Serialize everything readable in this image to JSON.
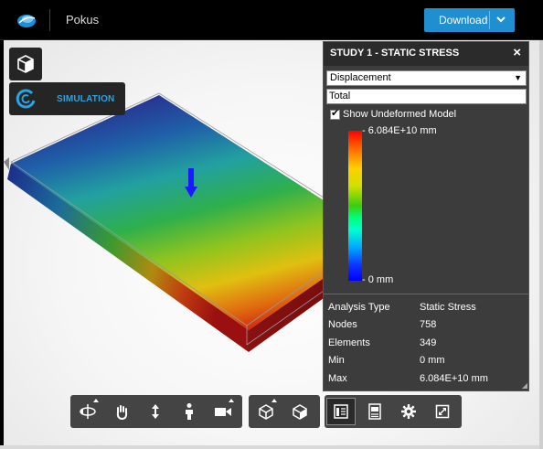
{
  "app": {
    "document_title": "Pokus",
    "download_label": "Download",
    "logo_icon": "fusion-logo-icon"
  },
  "left_tools": {
    "view_cube_icon": "view-cube-icon",
    "simulation_label": "SIMULATION",
    "simulation_icon": "simulation-icon"
  },
  "panel": {
    "title": "STUDY 1 - STATIC STRESS",
    "close_glyph": "×",
    "result_type": "Displacement",
    "component": "Total",
    "show_undeformed_label": "Show Undeformed Model",
    "show_undeformed_checked": true,
    "legend_max": "6.084E+10 mm",
    "legend_min": "0 mm",
    "legend_max_color": "#ff0000",
    "legend_min_color": "#0000ff",
    "info": [
      {
        "key": "Analysis Type",
        "value": "Static Stress"
      },
      {
        "key": "Nodes",
        "value": "758"
      },
      {
        "key": "Elements",
        "value": "349"
      },
      {
        "key": "Min",
        "value": "0 mm"
      },
      {
        "key": "Max",
        "value": "6.084E+10 mm"
      }
    ]
  },
  "toolbar": {
    "navigation": [
      "orbit-icon",
      "pan-icon",
      "zoom-icon",
      "look-at-icon",
      "camera-icon"
    ],
    "display": [
      "display-settings-icon",
      "view-icon"
    ],
    "simulation": [
      "results-panel-icon",
      "report-icon",
      "settings-icon",
      "fit-icon"
    ]
  },
  "colors": {
    "accent": "#1f8fd1",
    "simulation_label": "#2aa3e0",
    "panel_bg": "#3c3c3c",
    "toolbar_bg": "#444444"
  }
}
